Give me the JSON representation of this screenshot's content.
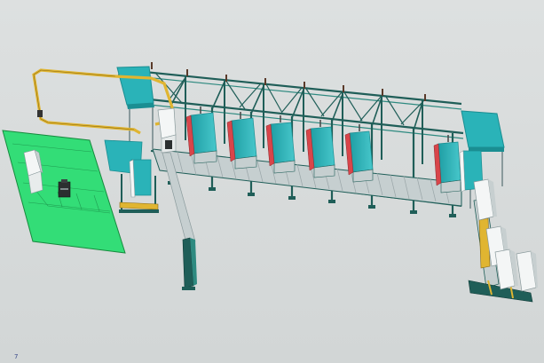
{
  "viewport": {
    "background": "#d9dcdc",
    "corner_label": "7"
  },
  "colors": {
    "frame": "#1f5e58",
    "frame_light": "#2e8a80",
    "cyan_panel": "#2ab3b8",
    "cyan_dark": "#1a8e92",
    "green_floor": "#33dd77",
    "green_edge": "#178a3e",
    "red_panel": "#d8454a",
    "yellow_rail": "#e0b531",
    "white_unit": "#f4f6f6",
    "roller": "#b9c3c4",
    "column_grey": "#8a9a9c"
  },
  "cabinets_on_line": 6,
  "scene_objects": [
    "overhead-gantry-frame",
    "cyan-roof-panel-left",
    "cyan-roof-panel-right",
    "yellow-gantry-rail",
    "roller-conveyor-main",
    "green-floor-pad",
    "vertical-column-conveyor",
    "exit-conveyor-right"
  ]
}
